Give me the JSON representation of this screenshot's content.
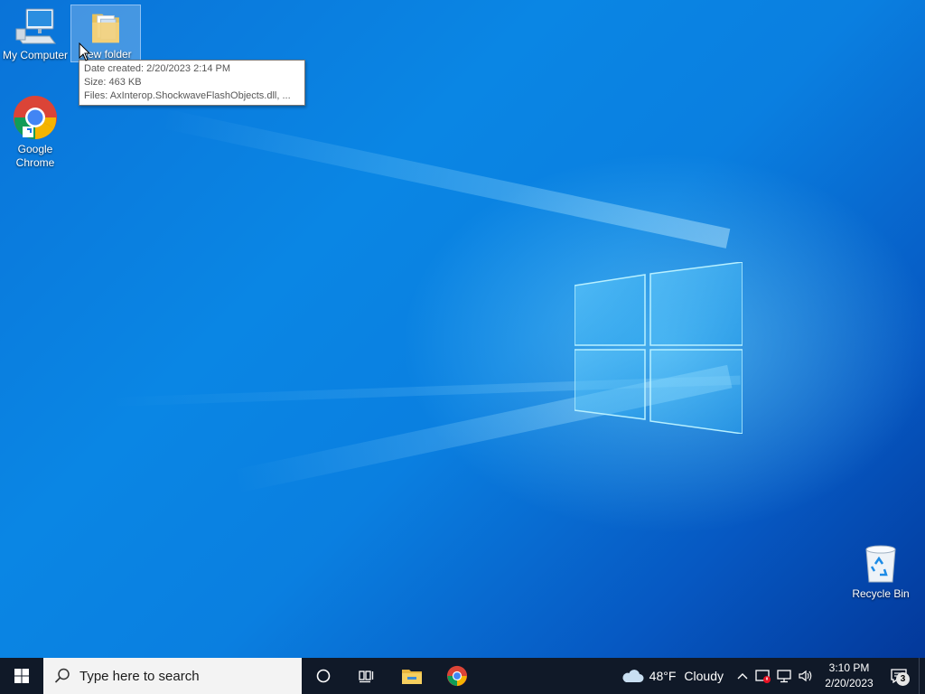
{
  "desktop": {
    "icons": [
      {
        "label": "My Computer"
      },
      {
        "label": "New folder"
      },
      {
        "label": "Google Chrome"
      },
      {
        "label": "Recycle Bin"
      }
    ],
    "tooltip": {
      "line1": "Date created: 2/20/2023 2:14 PM",
      "line2": "Size: 463 KB",
      "line3": "Files: AxInterop.ShockwaveFlashObjects.dll, ..."
    }
  },
  "taskbar": {
    "search_placeholder": "Type here to search",
    "pinned": [
      "cortana-circle-icon",
      "task-view-icon",
      "file-explorer-icon",
      "chrome-icon"
    ],
    "weather": {
      "temp": "48°F",
      "condition": "Cloudy"
    },
    "clock": {
      "time": "3:10 PM",
      "date": "2/20/2023"
    },
    "notifications_count": "3"
  },
  "colors": {
    "taskbar_bg": "#101928",
    "wallpaper_accent": "#0a86e4"
  }
}
